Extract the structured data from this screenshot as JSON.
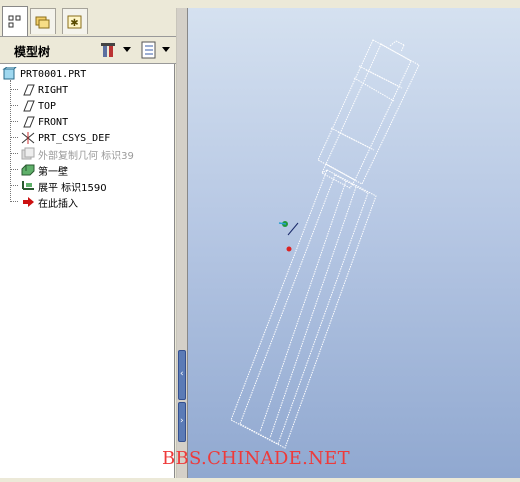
{
  "panel": {
    "title": "模型树"
  },
  "tabs": [
    {
      "name": "model-tree-tab",
      "icon": "model-tree-icon"
    },
    {
      "name": "folder-browser-tab",
      "icon": "folder-icon"
    },
    {
      "name": "favorites-tab",
      "icon": "favorites-icon"
    }
  ],
  "toolbar": {
    "settings_icon": "tools-icon",
    "show_icon": "list-icon"
  },
  "tree": {
    "root": "PRT0001.PRT",
    "items": [
      {
        "label": "RIGHT",
        "icon": "datum-plane-icon"
      },
      {
        "label": "TOP",
        "icon": "datum-plane-icon"
      },
      {
        "label": "FRONT",
        "icon": "datum-plane-icon"
      },
      {
        "label": "PRT_CSYS_DEF",
        "icon": "csys-icon"
      },
      {
        "label": "外部复制几何  标识39",
        "icon": "copy-geometry-icon",
        "suppressed": true
      },
      {
        "label": "第一壁",
        "icon": "first-wall-icon"
      },
      {
        "label": "展平  标识1590",
        "icon": "flatten-icon"
      },
      {
        "label": "在此插入",
        "icon": "insert-here-icon"
      }
    ]
  },
  "watermark": "BBS.CHINADE.NET",
  "colors": {
    "viewport_top": "#d5e1f0",
    "viewport_bottom": "#90a8d0",
    "watermark": "#ee3a3a",
    "insert_arrow": "#cc1111"
  }
}
